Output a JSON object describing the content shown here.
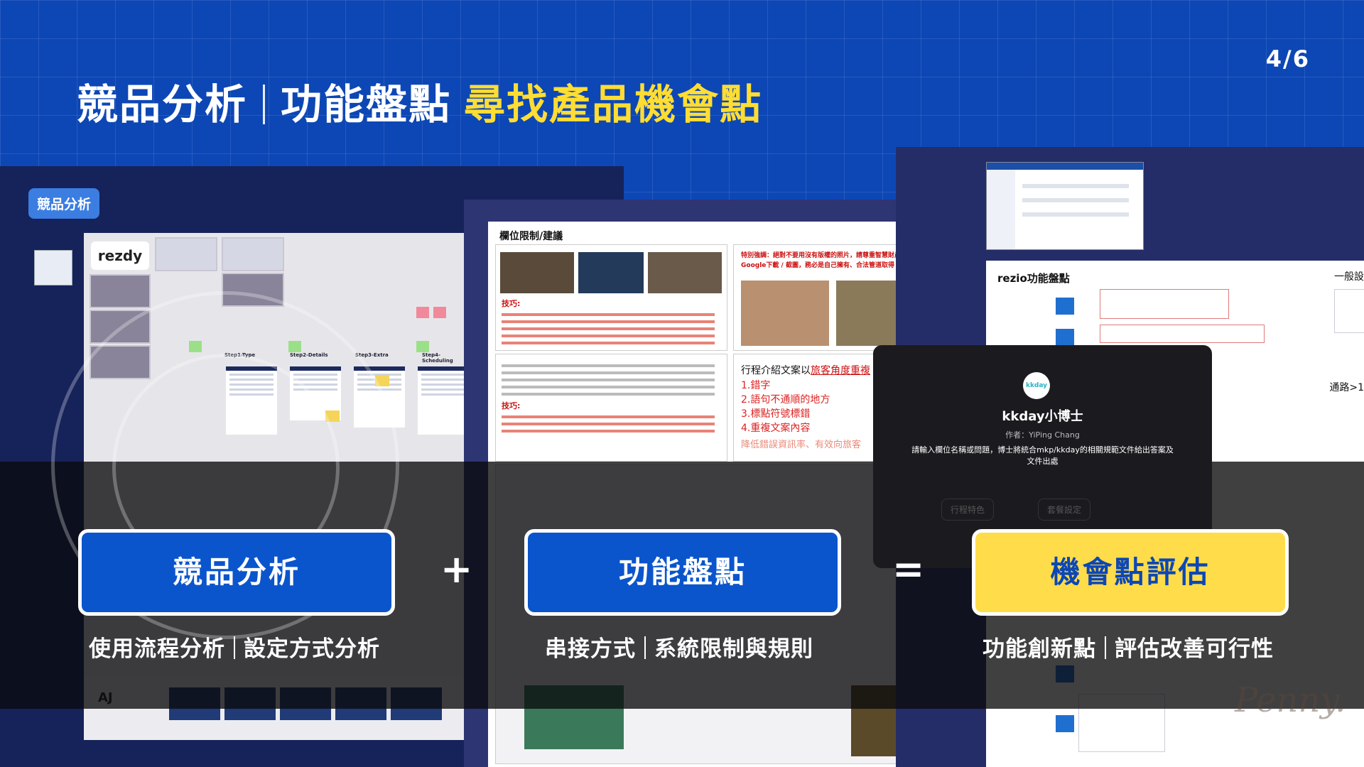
{
  "header": {
    "title_part1": "競品分析",
    "title_part2": "功能盤點",
    "title_highlight": "尋找產品機會點",
    "page_indicator": "4/6"
  },
  "left_panel": {
    "tag": "競品分析",
    "board_logo": "rezdy",
    "columns": [
      "Step1-Type",
      "Step2-Details",
      "Step3-Extra",
      "Step4-Scheduling"
    ],
    "bottom_logo": "AJ"
  },
  "middle_panel": {
    "doc_title": "欄位限制/建議",
    "notice": "特別強調：絕對不要用沒有版權的照片，請尊重智慧財產權 不可以用Google下載 / 截圖，務必是自己擁有、合法管道取得",
    "tips_label_1": "技巧:",
    "tips_label_2": "技巧:",
    "intro_heading": "行程介紹文案以",
    "intro_heading_em": "旅客角度重複",
    "intro_list": [
      "1.錯字",
      "2.語句不通順的地方",
      "3.標點符號標錯",
      "4.重複文案內容"
    ],
    "intro_footer": "降低錯誤資訊率、有效向旅客"
  },
  "right_panel": {
    "rez_title": "rezio功能盤點",
    "side_text_1": "一般設",
    "side_text_2": "通路>1"
  },
  "popup": {
    "avatar": "kkday",
    "name": "kkday小博士",
    "author": "作者：YiPing Chang",
    "description": "請輸入欄位名稱或問題，博士將統合mkp/kkday的相關規範文件給出答案及文件出處",
    "chips": [
      "行程特色",
      "套餐設定"
    ]
  },
  "formula": {
    "card1": "競品分析",
    "card2": "功能盤點",
    "card3": "機會點評估",
    "plus": "+",
    "equals": "=",
    "sub1_a": "使用流程分析",
    "sub1_b": "設定方式分析",
    "sub2_a": "串接方式",
    "sub2_b": "系統限制與規則",
    "sub3_a": "功能創新點",
    "sub3_b": "評估改善可行性"
  },
  "signature": "Penny.",
  "colors": {
    "background_blue": "#0d47b5",
    "highlight_yellow": "#ffdd33",
    "card_blue": "#0b55cc",
    "card_yellow": "#ffdd4a"
  }
}
